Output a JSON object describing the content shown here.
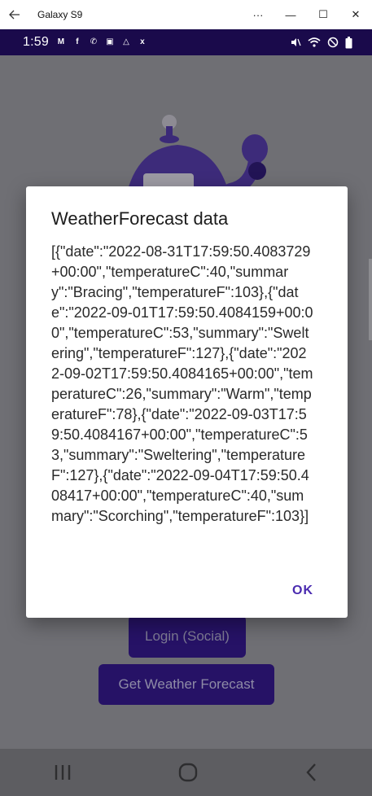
{
  "window": {
    "title": "Galaxy S9",
    "back_icon": "arrow-left-icon",
    "more_label": "···",
    "minimize_label": "—",
    "maximize_label": "☐",
    "close_label": "✕"
  },
  "status_bar": {
    "time": "1:59",
    "notifications": [
      "M",
      "f",
      "✆",
      "▣",
      "△",
      "x"
    ],
    "right_icons": [
      "mute-icon",
      "wifi-icon",
      "dnd-icon",
      "battery-icon"
    ]
  },
  "app": {
    "social_login_label": "Login (Social)",
    "weather_button_label": "Get Weather Forecast"
  },
  "dialog": {
    "title": "WeatherForecast data",
    "body": "[{\"date\":\"2022-08-31T17:59:50.4083729+00:00\",\"temperatureC\":40,\"summary\":\"Bracing\",\"temperatureF\":103},{\"date\":\"2022-09-01T17:59:50.4084159+00:00\",\"temperatureC\":53,\"summary\":\"Sweltering\",\"temperatureF\":127},{\"date\":\"2022-09-02T17:59:50.4084165+00:00\",\"temperatureC\":26,\"summary\":\"Warm\",\"temperatureF\":78},{\"date\":\"2022-09-03T17:59:50.4084167+00:00\",\"temperatureC\":53,\"summary\":\"Sweltering\",\"temperatureF\":127},{\"date\":\"2022-09-04T17:59:50.408417+00:00\",\"temperatureC\":40,\"summary\":\"Scorching\",\"temperatureF\":103}]",
    "ok_label": "OK"
  },
  "nav_bar": {
    "recents_label": "|||",
    "home_label": "◯",
    "back_label": "‹"
  },
  "colors": {
    "status_bar": "#1a0a4b",
    "accent": "#4a2bb0",
    "button": "#261266",
    "overlay": "#6f6f74"
  }
}
